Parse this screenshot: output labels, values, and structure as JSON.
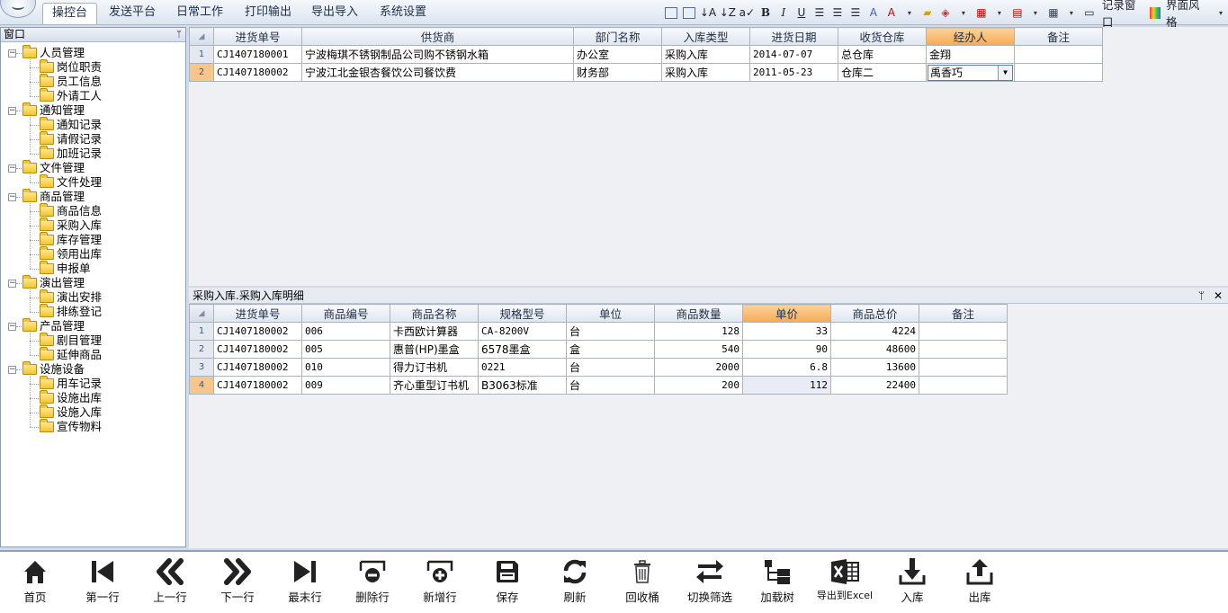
{
  "menu": {
    "tabs": [
      "操控台",
      "发送平台",
      "日常工作",
      "打印输出",
      "导出导入",
      "系统设置"
    ],
    "active_tab": "操控台"
  },
  "toolbar": {
    "record_window": "记录窗口",
    "ui_style": "界面风格",
    "bold": "B",
    "italic": "I",
    "underline": "U"
  },
  "left": {
    "title": "窗口",
    "pin": "ᛘ",
    "tree": [
      {
        "label": "人员管理",
        "children": [
          "岗位职责",
          "员工信息",
          "外请工人"
        ]
      },
      {
        "label": "通知管理",
        "children": [
          "通知记录",
          "请假记录",
          "加班记录"
        ]
      },
      {
        "label": "文件管理",
        "children": [
          "文件处理"
        ]
      },
      {
        "label": "商品管理",
        "children": [
          "商品信息",
          "采购入库",
          "库存管理",
          "领用出库",
          "申报单"
        ]
      },
      {
        "label": "演出管理",
        "children": [
          "演出安排",
          "排练登记"
        ]
      },
      {
        "label": "产品管理",
        "children": [
          "剧目管理",
          "延伸商品"
        ]
      },
      {
        "label": "设施设备",
        "children": [
          "用车记录",
          "设施出库",
          "设施入库",
          "宣传物料"
        ]
      }
    ]
  },
  "master": {
    "columns": [
      "进货单号",
      "供货商",
      "部门名称",
      "入库类型",
      "进货日期",
      "收货仓库",
      "经办人",
      "备注"
    ],
    "highlight_column": "经办人",
    "rows": [
      {
        "n": "1",
        "cells": [
          "CJ1407180001",
          "宁波梅琪不锈钢制品公司购不锈钢水箱",
          "办公室",
          "采购入库",
          "2014-07-07",
          "总仓库",
          "金翔",
          ""
        ]
      },
      {
        "n": "2",
        "cells": [
          "CJ1407180002",
          "宁波江北金银杏餐饮公司餐饮费",
          "财务部",
          "采购入库",
          "2011-05-23",
          "仓库二",
          "禹香巧",
          ""
        ]
      }
    ]
  },
  "detail": {
    "title": "采购入库.采购入库明细",
    "pin": "ᛘ",
    "close": "✕",
    "columns": [
      "进货单号",
      "商品编号",
      "商品名称",
      "规格型号",
      "单位",
      "商品数量",
      "单价",
      "商品总价",
      "备注"
    ],
    "highlight_column": "单价",
    "rows": [
      {
        "n": "1",
        "cells": [
          "CJ1407180002",
          "006",
          "卡西欧计算器",
          "CA-8200V",
          "台",
          "128",
          "33",
          "4224",
          ""
        ]
      },
      {
        "n": "2",
        "cells": [
          "CJ1407180002",
          "005",
          "惠普(HP)墨盒",
          "6578墨盒",
          "盒",
          "540",
          "90",
          "48600",
          ""
        ]
      },
      {
        "n": "3",
        "cells": [
          "CJ1407180002",
          "010",
          "得力订书机",
          "0221",
          "台",
          "2000",
          "6.8",
          "13600",
          ""
        ]
      },
      {
        "n": "4",
        "cells": [
          "CJ1407180002",
          "009",
          "齐心重型订书机",
          "B3063标准",
          "台",
          "200",
          "112",
          "22400",
          ""
        ]
      }
    ]
  },
  "bottom": {
    "buttons": [
      {
        "label": "首页",
        "icon": "home-icon"
      },
      {
        "label": "第一行",
        "icon": "first-row-icon"
      },
      {
        "label": "上一行",
        "icon": "prev-row-icon"
      },
      {
        "label": "下一行",
        "icon": "next-row-icon"
      },
      {
        "label": "最末行",
        "icon": "last-row-icon"
      },
      {
        "label": "删除行",
        "icon": "delete-row-icon"
      },
      {
        "label": "新增行",
        "icon": "add-row-icon"
      },
      {
        "label": "保存",
        "icon": "save-icon"
      },
      {
        "label": "刷新",
        "icon": "refresh-icon"
      },
      {
        "label": "回收桶",
        "icon": "trash-icon"
      },
      {
        "label": "切换筛选",
        "icon": "toggle-filter-icon"
      },
      {
        "label": "加载树",
        "icon": "load-tree-icon"
      },
      {
        "label": "导出到Excel",
        "icon": "excel-icon"
      },
      {
        "label": "入库",
        "icon": "inbound-icon"
      },
      {
        "label": "出库",
        "icon": "outbound-icon"
      }
    ]
  }
}
